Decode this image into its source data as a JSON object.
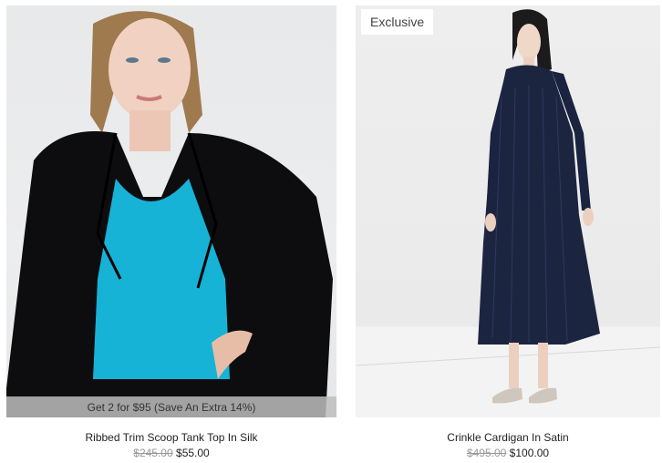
{
  "products": [
    {
      "name": "Ribbed Trim Scoop Tank Top In Silk",
      "original_price": "$245.00",
      "sale_price": "$55.00",
      "promo": "Get 2 for $95 (Save An Extra 14%)"
    },
    {
      "name": "Crinkle Cardigan In Satin",
      "original_price": "$495.00",
      "sale_price": "$100.00",
      "badge": "Exclusive"
    }
  ]
}
